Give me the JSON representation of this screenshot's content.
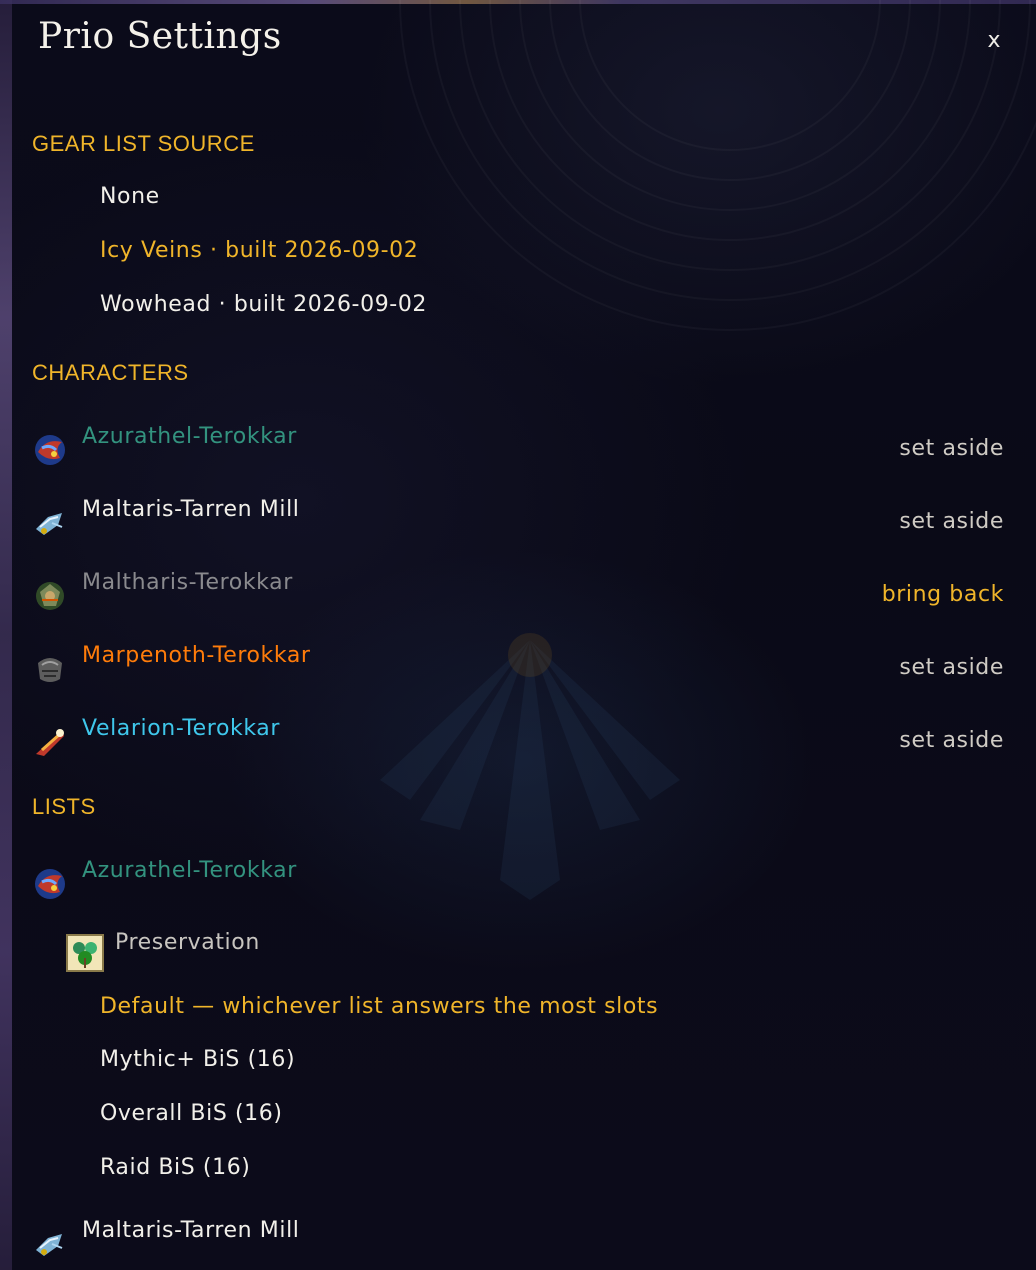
{
  "window": {
    "title": "Prio Settings",
    "close_label": "x"
  },
  "gear_list_source": {
    "heading": "GEAR LIST SOURCE",
    "options": [
      {
        "label": "None",
        "selected": false
      },
      {
        "label": "Icy Veins · built 2026-09-02",
        "selected": true
      },
      {
        "label": "Wowhead · built 2026-09-02",
        "selected": false
      }
    ]
  },
  "characters": {
    "heading": "CHARACTERS",
    "items": [
      {
        "name": "Azurathel-Terokkar",
        "class_color": "#33937f",
        "icon": "evoker-class-icon",
        "action": "set aside",
        "active": true
      },
      {
        "name": "Maltaris-Tarren Mill",
        "class_color": "#f2f0ea",
        "icon": "shaman-class-icon",
        "action": "set aside",
        "active": true
      },
      {
        "name": "Maltharis-Terokkar",
        "class_color": "#8a8a8e",
        "icon": "hunter-class-icon",
        "action": "bring back",
        "active": false
      },
      {
        "name": "Marpenoth-Terokkar",
        "class_color": "#ff7c0a",
        "icon": "druid-class-icon",
        "action": "set aside",
        "active": true
      },
      {
        "name": "Velarion-Terokkar",
        "class_color": "#3fc7eb",
        "icon": "mage-class-icon",
        "action": "set aside",
        "active": true
      }
    ]
  },
  "lists": {
    "heading": "LISTS",
    "character": "Azurathel-Terokkar",
    "spec": "Preservation",
    "options": [
      {
        "label": "Default — whichever list answers the most slots",
        "selected": true
      },
      {
        "label": "Mythic+ BiS (16)",
        "selected": false
      },
      {
        "label": "Overall BiS (16)",
        "selected": false
      },
      {
        "label": "Raid BiS (16)",
        "selected": false
      }
    ],
    "next_character": "Maltaris-Tarren Mill"
  },
  "colors": {
    "accent_gold": "#f0b52a",
    "text_white": "#f2f0ea",
    "background": "#0a0a17"
  }
}
